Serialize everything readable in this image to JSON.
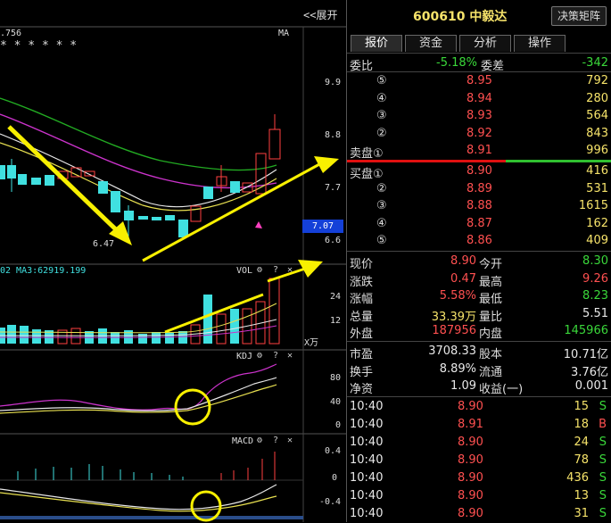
{
  "chart": {
    "expand_label": "<<展开",
    "price_text": ".756",
    "ma_label": "MA",
    "stars": "* * *   * *   *",
    "y_main": [
      "9.9",
      "8.8",
      "7.7",
      "6.6"
    ],
    "current_price_tag": "7.07",
    "low_annotation": "6.47",
    "vol_title": "02  MA3:62919.199",
    "vol_label": "VOL",
    "vol_y": [
      "24",
      "12"
    ],
    "vol_unit": "X万",
    "kdj_label": "KDJ",
    "kdj_y": [
      "80",
      "40",
      "0"
    ],
    "macd_label": "MACD",
    "macd_y": [
      "0.4",
      "0",
      "-0.4"
    ],
    "icons": {
      "gear": "gear-icon",
      "help": "question-icon",
      "close": "close-icon"
    }
  },
  "quote": {
    "code_name": "600610 中毅达",
    "decision_btn": "决策矩阵",
    "tabs": [
      "报价",
      "资金",
      "分析",
      "操作"
    ],
    "weibi_label": "委比",
    "weibi_value": "-5.18%",
    "weicha_label": "委差",
    "weicha_value": "-342",
    "sell": [
      {
        "level": "⑤",
        "price": "8.95",
        "vol": "792"
      },
      {
        "level": "④",
        "price": "8.94",
        "vol": "280"
      },
      {
        "level": "③",
        "price": "8.93",
        "vol": "564"
      },
      {
        "level": "②",
        "price": "8.92",
        "vol": "843"
      },
      {
        "level": "卖盘①",
        "price": "8.91",
        "vol": "996"
      }
    ],
    "buy": [
      {
        "level": "买盘①",
        "price": "8.90",
        "vol": "416"
      },
      {
        "level": "②",
        "price": "8.89",
        "vol": "531"
      },
      {
        "level": "③",
        "price": "8.88",
        "vol": "1615"
      },
      {
        "level": "④",
        "price": "8.87",
        "vol": "162"
      },
      {
        "level": "⑤",
        "price": "8.86",
        "vol": "409"
      }
    ],
    "stats": [
      {
        "l1": "现价",
        "v1": "8.90",
        "c1": "red",
        "l2": "今开",
        "v2": "8.30",
        "c2": "green"
      },
      {
        "l1": "涨跌",
        "v1": "0.47",
        "c1": "red",
        "l2": "最高",
        "v2": "9.26",
        "c2": "red"
      },
      {
        "l1": "涨幅",
        "v1": "5.58%",
        "c1": "red",
        "l2": "最低",
        "v2": "8.23",
        "c2": "green"
      },
      {
        "l1": "总量",
        "v1": "33.39万",
        "c1": "yel",
        "l2": "量比",
        "v2": "5.51",
        "c2": "wht"
      },
      {
        "l1": "外盘",
        "v1": "187956",
        "c1": "red",
        "l2": "内盘",
        "v2": "145966",
        "c2": "green"
      }
    ],
    "fund": [
      {
        "l1": "市盈",
        "v1": "3708.33",
        "l2": "股本",
        "v2": "10.71亿"
      },
      {
        "l1": "换手",
        "v1": "8.89%",
        "l2": "流通",
        "v2": "3.76亿"
      },
      {
        "l1": "净资",
        "v1": "1.09",
        "l2": "收益(一)",
        "v2": "0.001"
      }
    ],
    "ticks": [
      {
        "time": "10:40",
        "price": "8.90",
        "pc": "red",
        "vol": "15",
        "side": "S"
      },
      {
        "time": "10:40",
        "price": "8.91",
        "pc": "red",
        "vol": "18",
        "side": "B"
      },
      {
        "time": "10:40",
        "price": "8.90",
        "pc": "red",
        "vol": "24",
        "side": "S"
      },
      {
        "time": "10:40",
        "price": "8.90",
        "pc": "red",
        "vol": "78",
        "side": "S"
      },
      {
        "time": "10:40",
        "price": "8.90",
        "pc": "red",
        "vol": "436",
        "side": "S"
      },
      {
        "time": "10:40",
        "price": "8.90",
        "pc": "red",
        "vol": "13",
        "side": "S"
      },
      {
        "time": "10:40",
        "price": "8.90",
        "pc": "red",
        "vol": "31",
        "side": "S"
      }
    ]
  }
}
